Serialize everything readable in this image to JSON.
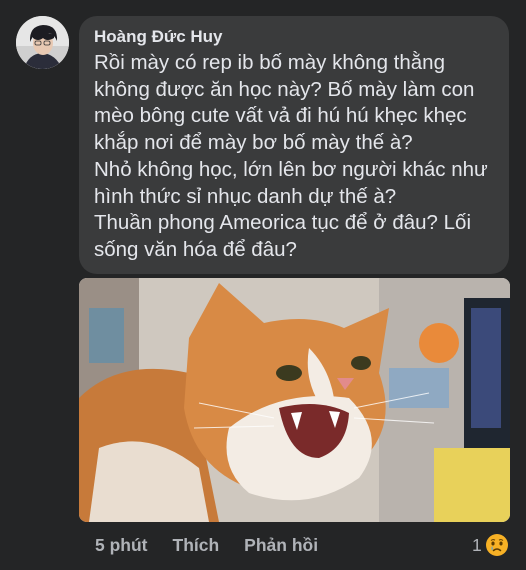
{
  "comment": {
    "author": "Hoàng Đức Huy",
    "text_lines": [
      "Rồi mày có rep ib bố mày không thằng",
      "không được ăn học này? Bố mày làm con",
      "mèo bông cute vất vả đi hú hú khẹc khẹc",
      "khắp nơi để mày bơ bố mày thế à?",
      "Nhỏ không học, lớn lên bơ người khác như",
      "hình thức sỉ nhục danh dự thế à?",
      "Thuần phong Ameorica tục để ở đâu? Lối",
      "sống văn hóa để đâu?"
    ],
    "attachment_icon": "angry-cat-photo",
    "avatar_icon": "user-avatar"
  },
  "actions": {
    "time": "5 phút",
    "like_label": "Thích",
    "reply_label": "Phản hồi"
  },
  "reactions": {
    "count": "1",
    "emoji_icon": "sad-crying-face"
  },
  "colors": {
    "background": "#242526",
    "bubble": "#3a3b3c",
    "text": "#e4e6eb",
    "secondary_text": "#b0b3b8"
  }
}
